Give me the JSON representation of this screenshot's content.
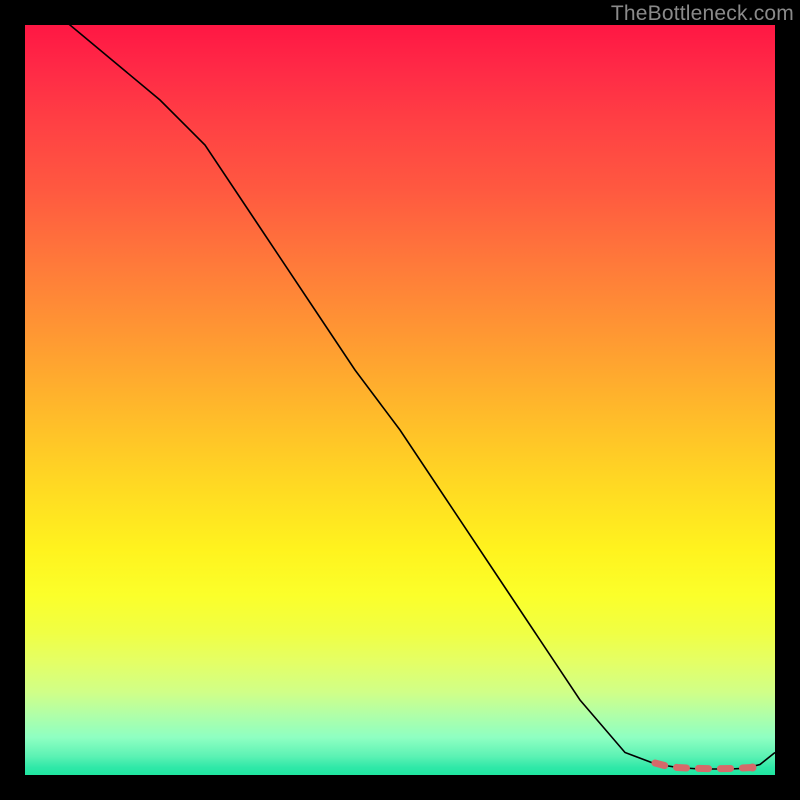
{
  "watermark": "TheBottleneck.com",
  "chart_data": {
    "type": "line",
    "title": "",
    "xlabel": "",
    "ylabel": "",
    "xlim": [
      0,
      100
    ],
    "ylim": [
      0,
      100
    ],
    "series": [
      {
        "name": "curve",
        "x": [
          0,
          6,
          12,
          18,
          24,
          28,
          32,
          38,
          44,
          50,
          56,
          62,
          68,
          74,
          80,
          84,
          87,
          90,
          92,
          94,
          96,
          98,
          100
        ],
        "y": [
          104,
          100,
          95,
          90,
          84,
          78,
          72,
          63,
          54,
          46,
          37,
          28,
          19,
          10,
          3,
          1.5,
          1,
          0.8,
          0.8,
          0.8,
          0.9,
          1.4,
          3
        ],
        "stroke": "#000000",
        "stroke_width": 1.6
      },
      {
        "name": "highlight",
        "x": [
          84,
          85.5,
          87,
          89,
          91,
          93,
          95,
          97
        ],
        "y": [
          1.6,
          1.2,
          1.0,
          0.9,
          0.85,
          0.85,
          0.9,
          1.0
        ],
        "stroke": "#d66a6a",
        "stroke_width": 7,
        "dashed": true
      }
    ],
    "marker": {
      "x": 97,
      "y": 1.0,
      "r": 4,
      "fill": "#d66a6a"
    }
  }
}
